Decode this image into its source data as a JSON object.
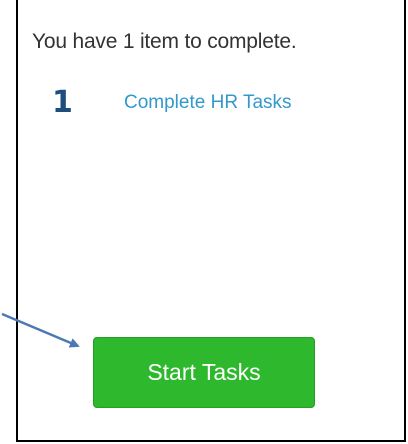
{
  "summary": {
    "text": "You have 1 item to complete."
  },
  "tasks": [
    {
      "count": "1",
      "label": "Complete HR Tasks"
    }
  ],
  "actions": {
    "start_label": "Start Tasks"
  },
  "colors": {
    "accent_button": "#2db82d",
    "link": "#3399cc",
    "count": "#1e4e7d",
    "arrow": "#4a79b3"
  }
}
